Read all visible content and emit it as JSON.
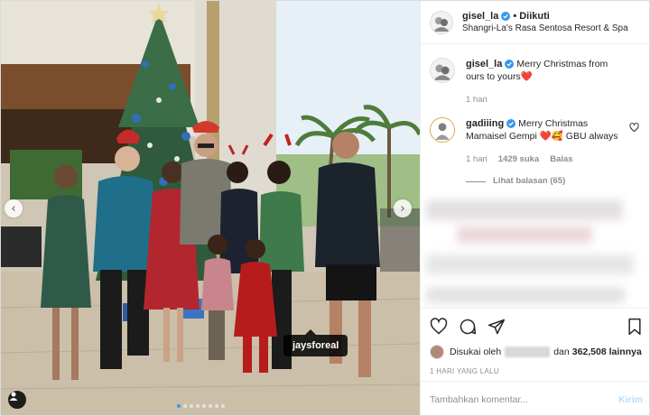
{
  "post": {
    "author": "gisel_la",
    "follow_status": "Diikuti",
    "location": "Shangri-La's Rasa Sentosa Resort & Spa",
    "photo_tag": "jaysforeal",
    "carousel": {
      "count": 8,
      "active_index": 0
    }
  },
  "caption": {
    "username": "gisel_la",
    "text": "Merry Christmas from ours to yours",
    "emoji": "❤️",
    "age": "1 hari"
  },
  "comment": {
    "username": "gadiiing",
    "text": "Merry Christmas Mamaisel Gempi",
    "emoji": "❤️🥰",
    "suffix": "GBU always",
    "age": "1 hari",
    "likes": "1429 suka",
    "reply_label": "Balas",
    "view_replies": "Lihat balasan (65)"
  },
  "likes": {
    "prefix": "Disukai oleh",
    "middle": "dan",
    "count": "362,508 lainnya"
  },
  "timestamp": "1 HARI YANG LALU",
  "composer": {
    "placeholder": "Tambahkan komentar...",
    "post_label": "Kirim"
  },
  "colors": {
    "verified": "#3897f0",
    "link_disabled": "#b2dffc",
    "heart": "#ed4956"
  }
}
